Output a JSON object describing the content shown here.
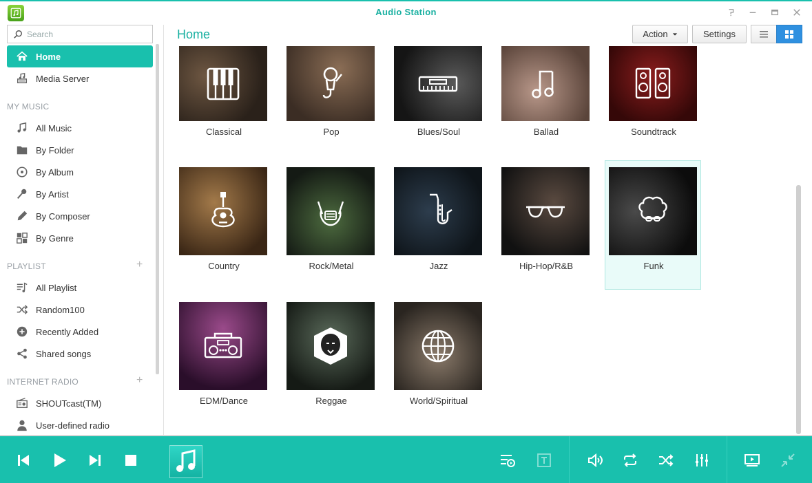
{
  "window": {
    "title": "Audio Station",
    "help": "?",
    "minimize": "—",
    "maximize": "▭",
    "close": "✕"
  },
  "search": {
    "placeholder": "Search"
  },
  "nav": {
    "home": "Home",
    "media_server": "Media Server",
    "my_music_label": "MY MUSIC",
    "all_music": "All Music",
    "by_folder": "By Folder",
    "by_album": "By Album",
    "by_artist": "By Artist",
    "by_composer": "By Composer",
    "by_genre": "By Genre",
    "playlist_label": "PLAYLIST",
    "all_playlist": "All Playlist",
    "random100": "Random100",
    "recently_added": "Recently Added",
    "shared_songs": "Shared songs",
    "internet_radio_label": "INTERNET RADIO",
    "shoutcast": "SHOUTcast(TM)",
    "user_defined_radio": "User-defined radio",
    "plus": "+"
  },
  "main": {
    "title": "Home",
    "action_label": "Action",
    "settings_label": "Settings"
  },
  "genres": [
    {
      "label": "Classical",
      "icon": "piano-icon"
    },
    {
      "label": "Pop",
      "icon": "microphone-icon"
    },
    {
      "label": "Blues/Soul",
      "icon": "keyboard-icon"
    },
    {
      "label": "Ballad",
      "icon": "music-note-icon"
    },
    {
      "label": "Soundtrack",
      "icon": "speakers-icon"
    },
    {
      "label": "Country",
      "icon": "acoustic-guitar-icon"
    },
    {
      "label": "Rock/Metal",
      "icon": "rock-hand-icon"
    },
    {
      "label": "Jazz",
      "icon": "saxophone-icon"
    },
    {
      "label": "Hip-Hop/R&B",
      "icon": "sunglasses-icon"
    },
    {
      "label": "Funk",
      "icon": "afro-icon",
      "selected": true
    },
    {
      "label": "EDM/Dance",
      "icon": "boombox-icon"
    },
    {
      "label": "Reggae",
      "icon": "lion-icon"
    },
    {
      "label": "World/Spiritual",
      "icon": "globe-icon"
    }
  ],
  "colors": {
    "accent": "#19c0ad",
    "accent_text": "#19b0a1",
    "selected_tile": "#e9fbf9"
  }
}
